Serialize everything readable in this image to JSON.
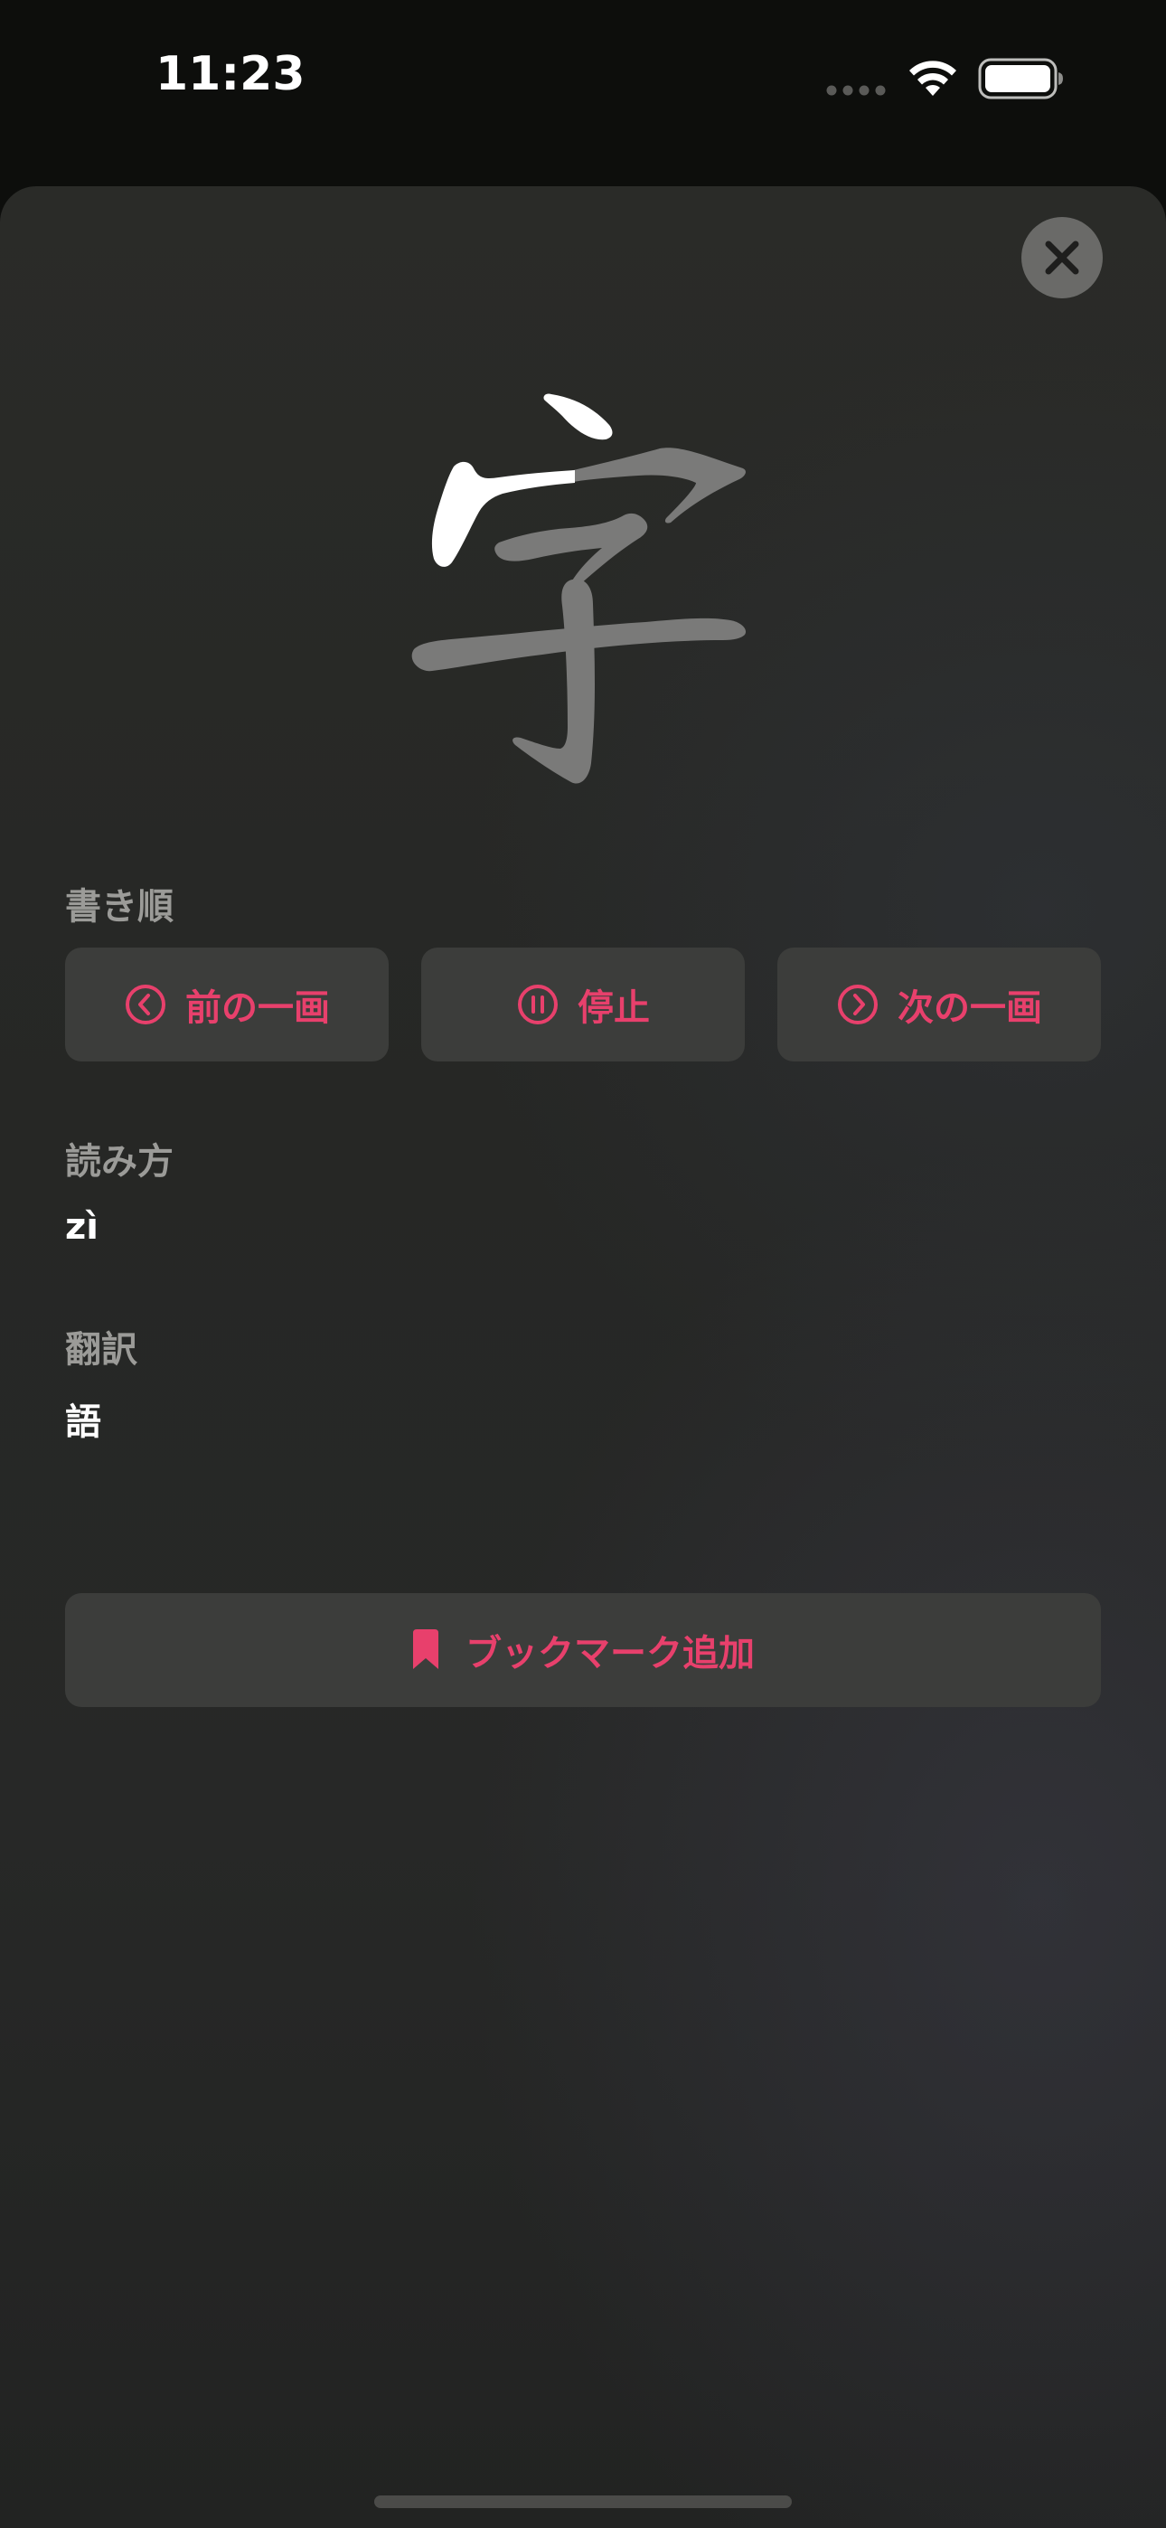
{
  "status_bar": {
    "time": "11:23",
    "wifi_icon": "wifi-icon",
    "battery_icon": "battery-full-icon"
  },
  "sheet": {
    "close_icon": "close-icon",
    "character": "字",
    "character_total_strokes": 6,
    "character_strokes_completed": 2,
    "stroke_order": {
      "label": "書き順",
      "previous_label": "前の一画",
      "pause_label": "停止",
      "next_label": "次の一画"
    },
    "reading": {
      "label": "読み方",
      "value": "zì"
    },
    "translation": {
      "label": "翻訳",
      "value": "語"
    },
    "bookmark_label": "ブックマーク追加"
  },
  "colors": {
    "accent": "#e8406c",
    "stroke_done": "#ffffff",
    "stroke_pending": "#7a7a79",
    "button_bg": "#3c3d3b",
    "label_gray": "#9b9b98"
  }
}
